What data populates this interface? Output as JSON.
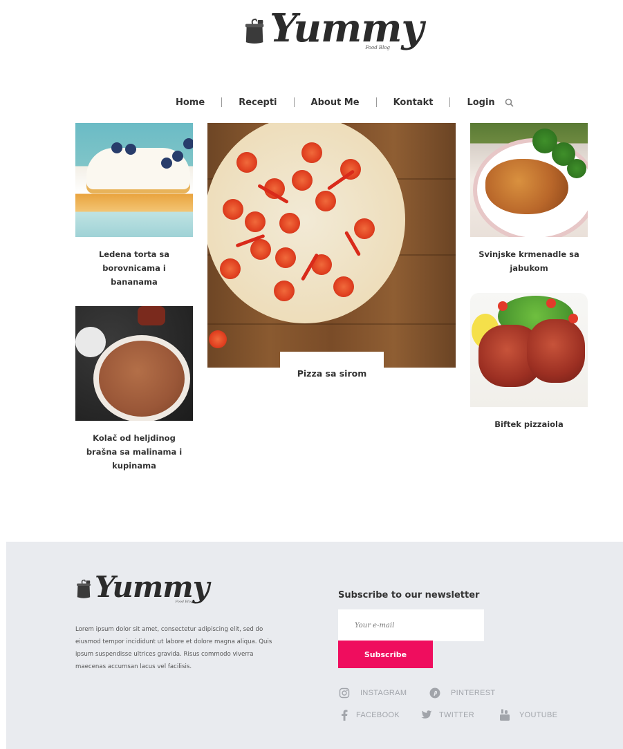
{
  "brand": {
    "name": "Yummy",
    "tagline": "Food Blog"
  },
  "nav": {
    "items": [
      {
        "label": "Home"
      },
      {
        "label": "Recepti"
      },
      {
        "label": "About Me"
      },
      {
        "label": "Kontakt"
      },
      {
        "label": "Login"
      }
    ],
    "search_icon": "search-icon"
  },
  "recipes": {
    "cake": {
      "title_line1": "Ledena torta sa",
      "title_line2": "borovnicama i",
      "title_line3": "bananama"
    },
    "kolac": {
      "title_line1": "Kolač od heljdinog",
      "title_line2": "brašna sa malinama i",
      "title_line3": "kupinama"
    },
    "pizza": {
      "title": "Pizza sa sirom"
    },
    "pork": {
      "title_line1": "Svinjske krmenadle sa",
      "title_line2": "jabukom"
    },
    "steak": {
      "title": "Biftek pizzaiola"
    }
  },
  "footer": {
    "about_text": "Lorem ipsum dolor sit amet, consectetur adipiscing elit, sed do eiusmod tempor incididunt ut labore et dolore magna aliqua. Quis ipsum suspendisse ultrices gravida. Risus commodo viverra maecenas accumsan lacus vel facilisis.",
    "newsletter": {
      "title": "Subscribe to our newsletter",
      "email_placeholder": "Your e-mail",
      "email_value": "",
      "subscribe_label": "Subscribe"
    },
    "social": [
      {
        "label": "INSTAGRAM",
        "icon": "instagram-icon"
      },
      {
        "label": "PINTEREST",
        "icon": "pinterest-icon"
      },
      {
        "label": "FACEBOOK",
        "icon": "facebook-icon"
      },
      {
        "label": "TWITTER",
        "icon": "twitter-icon"
      },
      {
        "label": "YOUTUBE",
        "icon": "youtube-icon"
      }
    ]
  },
  "colors": {
    "accent": "#ef0d5e",
    "footer_bg": "#e9ebef",
    "text_dark": "#333333",
    "social_gray": "#a1a4aa"
  }
}
